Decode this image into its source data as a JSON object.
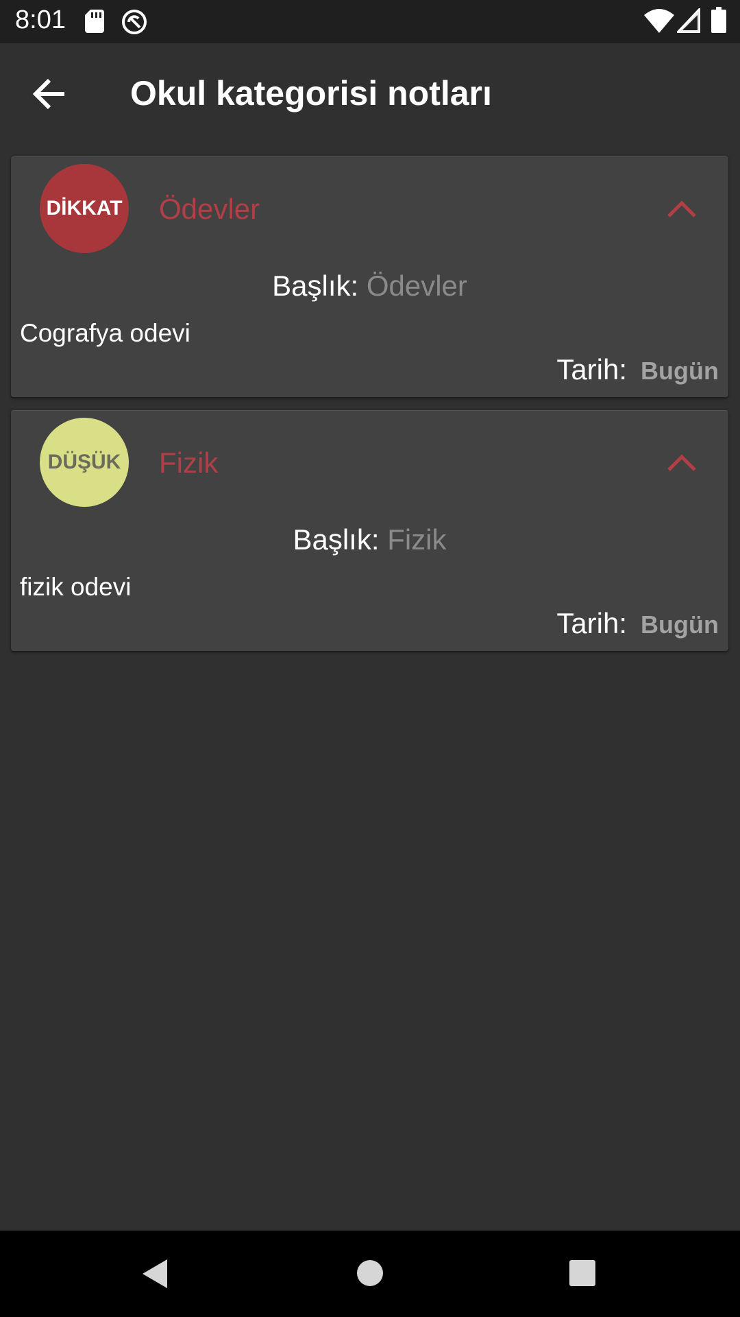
{
  "status_bar": {
    "time": "8:01",
    "icons": [
      "sd-card-icon",
      "sync-icon",
      "wifi-icon",
      "cell-signal-icon",
      "battery-icon"
    ]
  },
  "app_bar": {
    "title": "Okul kategorisi notları",
    "back_icon": "arrow-back-icon"
  },
  "notes": [
    {
      "priority": "DİKKAT",
      "priority_color": "#a8373c",
      "title": "Ödevler",
      "baslik_label": "Başlık:",
      "baslik_value": "Ödevler",
      "text": "Cografya odevi",
      "tarih_label": "Tarih:",
      "tarih_value": "Bugün"
    },
    {
      "priority": "DÜŞÜK",
      "priority_color": "#d8df86",
      "title": "Fizik",
      "baslik_label": "Başlık:",
      "baslik_value": "Fizik",
      "text": "fizik odevi",
      "tarih_label": "Tarih:",
      "tarih_value": "Bugün"
    }
  ],
  "colors": {
    "background": "#303030",
    "card": "#424242",
    "title_accent": "#b23f46"
  },
  "nav_bar": {
    "icons": [
      "nav-back-icon",
      "nav-home-icon",
      "nav-recents-icon"
    ]
  }
}
